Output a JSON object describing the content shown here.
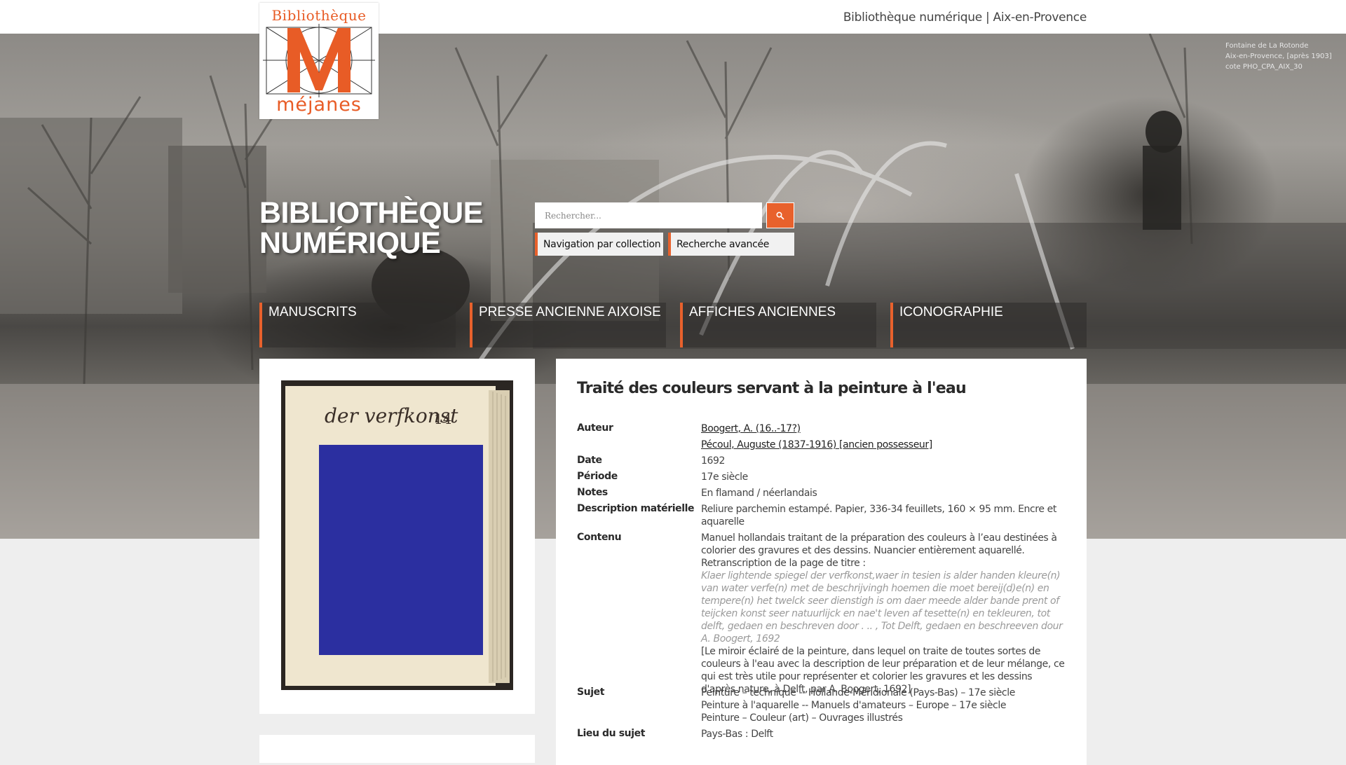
{
  "header": {
    "site_name": "Bibliothèque numérique | Aix-en-Provence"
  },
  "logo": {
    "top_text": "Bibliothèque",
    "bottom_text": "méjanes",
    "monogram": "M"
  },
  "hero": {
    "title_line1": "BIBLIOTHÈQUE",
    "title_line2": "NUMÉRIQUE",
    "caption_line1": "Fontaine de La Rotonde",
    "caption_line2": "Aix-en-Provence, [après 1903]",
    "caption_line3": "cote PHO_CPA_AIX_30"
  },
  "search": {
    "placeholder": "Rechercher...",
    "icon": "search-icon",
    "browse_label": "Navigation par collection",
    "advanced_label": "Recherche avancée"
  },
  "collections": [
    {
      "label": "MANUSCRITS"
    },
    {
      "label": "PRESSE ANCIENNE AIXOISE"
    },
    {
      "label": "AFFICHES ANCIENNES"
    },
    {
      "label": "ICONOGRAPHIE"
    }
  ],
  "thumbnail": {
    "handwriting": "der verfkonst",
    "page_number": "14"
  },
  "record": {
    "title": "Traité des couleurs servant à la peinture à l'eau",
    "author_label": "Auteur",
    "author_1": "Boogert, A. (16..-17?)",
    "author_2": "Pécoul, Auguste (1837-1916) [ancien possesseur]",
    "date_label": "Date",
    "date": "1692",
    "period_label": "Période",
    "period": "17e siècle",
    "notes_label": "Notes",
    "notes": "En flamand / néerlandais",
    "desc_label": "Description matérielle",
    "desc": "Reliure parchemin estampé. Papier, 336-34 feuillets, 160 × 95 mm. Encre et aquarelle",
    "content_label": "Contenu",
    "content_line1": "Manuel hollandais traitant de la préparation des couleurs à l’eau destinées à colorier des gravures et des dessins. Nuancier entièrement aquarellé.",
    "content_line2": "Retranscription de la page de titre :",
    "content_italic": "Klaer lightende spiegel der verfkonst,waer in tesien is alder handen kleure(n) van water verfe(n) met de beschrijvingh hoemen die moet bereij(d)e(n) en tempere(n) het twelck seer dienstigh is om daer meede alder bande prent of teijcken konst seer natuurlijck en nae't leven af tesette(n) en tekleuren, tot delft, gedaen en beschreven door . .. , Tot Delft, gedaen en beschreeven dour A. Boogert, 1692",
    "content_translation": "[Le miroir éclairé de la peinture, dans lequel on traite de toutes sortes de couleurs à l'eau avec la description de leur préparation et de leur mélange, ce qui est très utile pour représenter et colorier les gravures et les dessins d'après nature, à Delft, par A. Boogert, 1692]",
    "subject_label": "Sujet",
    "subject_1": "Peinture – technique -- Hollande-Méridionale (Pays-Bas) – 17e siècle",
    "subject_2": "Peinture à l'aquarelle -- Manuels d'amateurs – Europe – 17e siècle",
    "subject_3": "Peinture – Couleur (art) – Ouvrages illustrés",
    "place_label": "Lieu du sujet",
    "place": "Pays-Bas : Delft"
  },
  "colors": {
    "accent": "#e8612c",
    "swatch_blue": "#2b2fa0",
    "paper": "#efe6cf"
  }
}
